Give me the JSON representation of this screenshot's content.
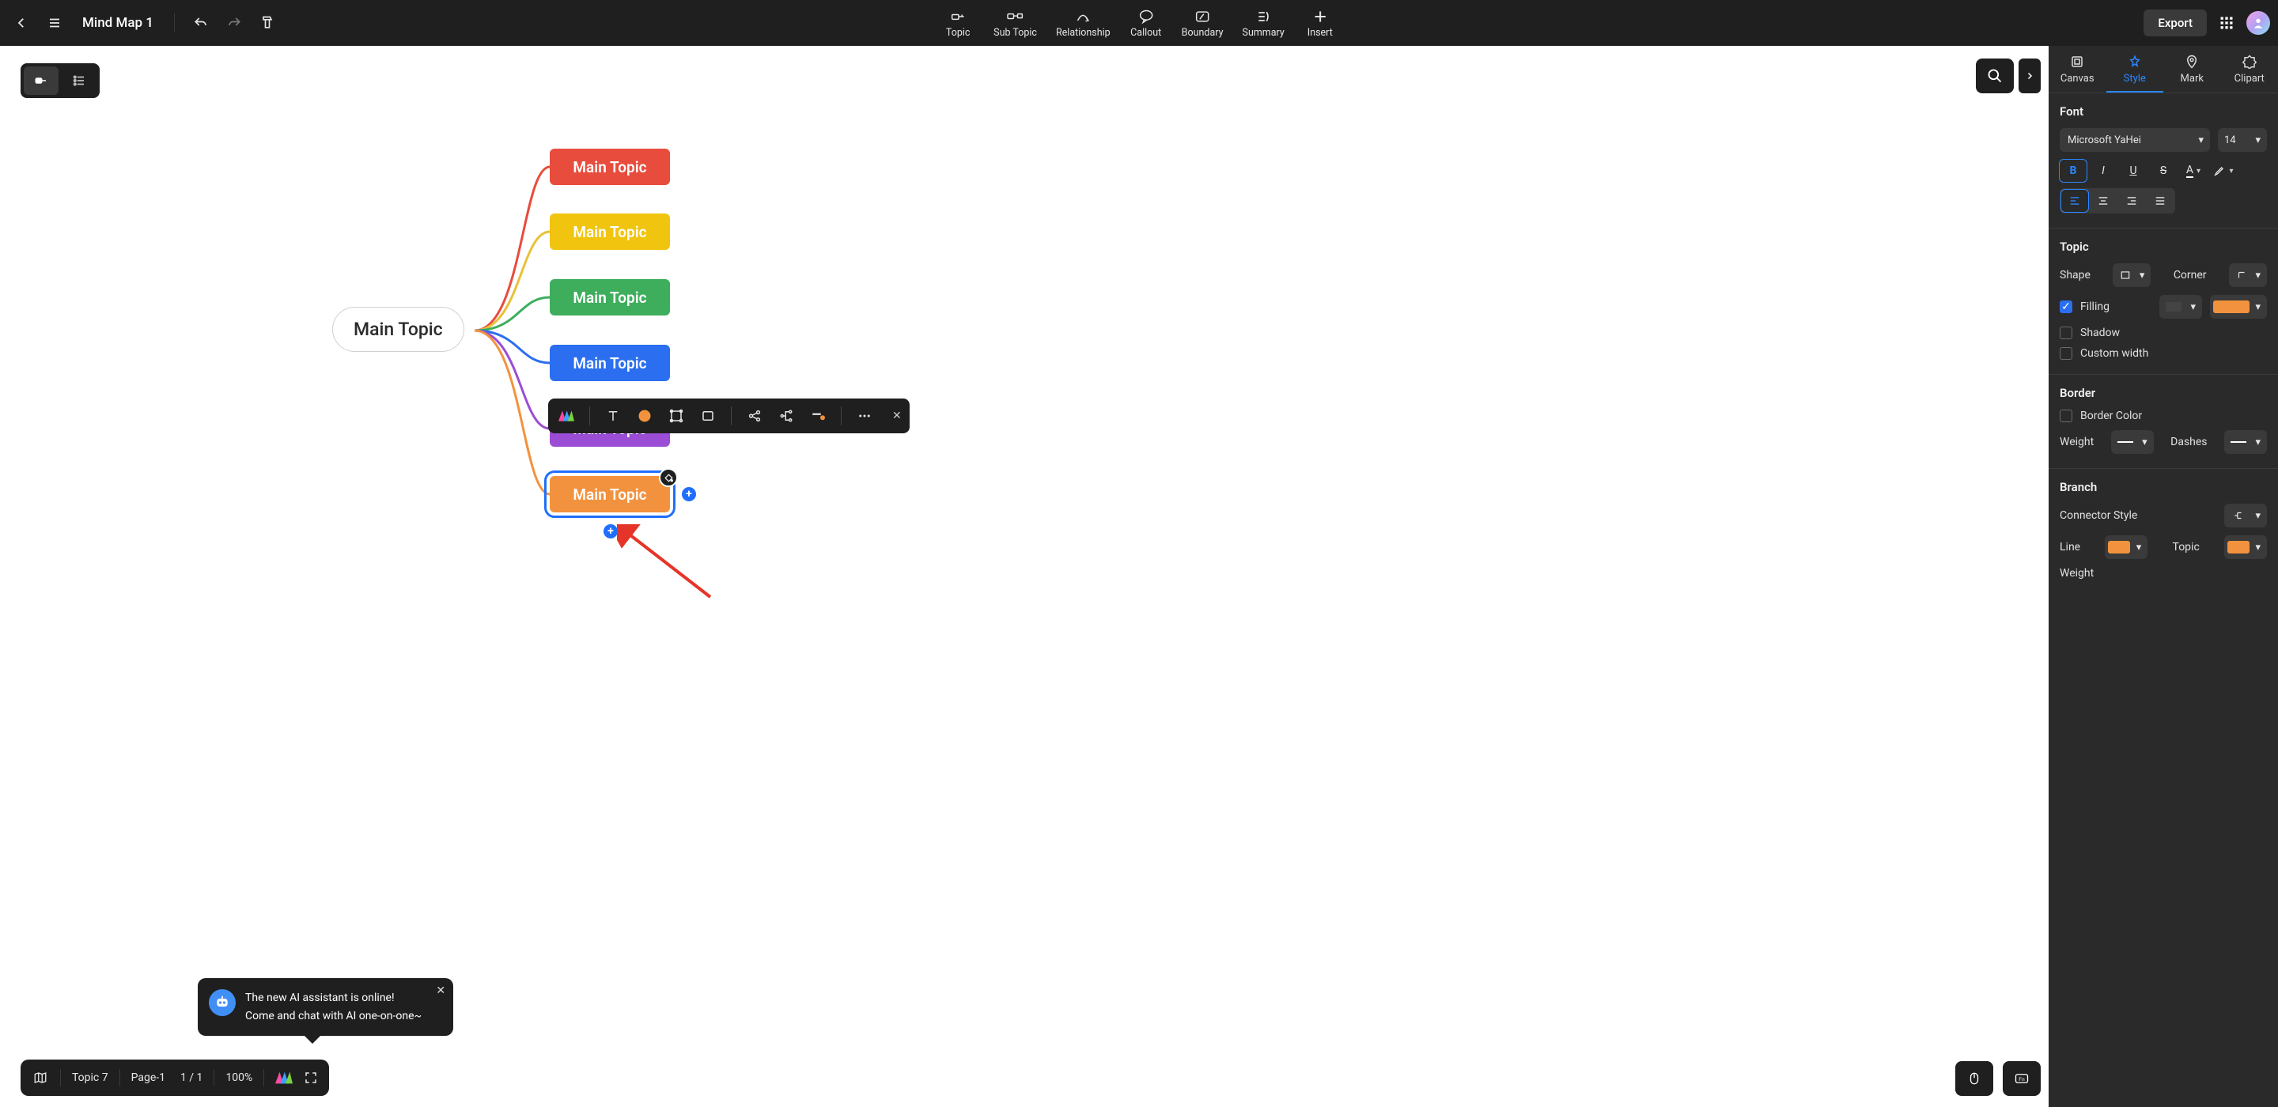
{
  "doc_title": "Mind Map 1",
  "toolbar": [
    {
      "id": "topic",
      "label": "Topic"
    },
    {
      "id": "subtopic",
      "label": "Sub Topic"
    },
    {
      "id": "relationship",
      "label": "Relationship"
    },
    {
      "id": "callout",
      "label": "Callout"
    },
    {
      "id": "boundary",
      "label": "Boundary"
    },
    {
      "id": "summary",
      "label": "Summary"
    },
    {
      "id": "insert",
      "label": "Insert"
    }
  ],
  "export_label": "Export",
  "mindmap": {
    "center_label": "Main Topic",
    "children": [
      {
        "label": "Main Topic",
        "color": "#e84c3d",
        "line": "#e84c3d"
      },
      {
        "label": "Main Topic",
        "color": "#f1c40f",
        "line": "#e8c13a"
      },
      {
        "label": "Main Topic",
        "color": "#3eae5d",
        "line": "#3eae5d"
      },
      {
        "label": "Main Topic",
        "color": "#2b6ff0",
        "line": "#2b6ff0"
      },
      {
        "label": "Main Topic",
        "color": "#9b4dd6",
        "line": "#9b4dd6"
      },
      {
        "label": "Main Topic",
        "color": "#f3923e",
        "line": "#f3923e",
        "selected": true
      }
    ]
  },
  "ai_popup": {
    "line1": "The new AI assistant is online!",
    "line2": "Come and chat with AI one-on-one~"
  },
  "status": {
    "topic": "Topic 7",
    "page_label": "Page-1",
    "page_count": "1 / 1",
    "zoom": "100%"
  },
  "panel": {
    "tabs": [
      "Canvas",
      "Style",
      "Mark",
      "Clipart"
    ],
    "active_tab": 1,
    "font": {
      "title": "Font",
      "family": "Microsoft YaHei",
      "size": "14"
    },
    "topic": {
      "title": "Topic",
      "shape_label": "Shape",
      "corner_label": "Corner",
      "filling_label": "Filling",
      "fill_color": "#f3923e",
      "shadow_label": "Shadow",
      "custom_width_label": "Custom width"
    },
    "border": {
      "title": "Border",
      "border_color_label": "Border Color",
      "weight_label": "Weight",
      "dashes_label": "Dashes"
    },
    "branch": {
      "title": "Branch",
      "connector_label": "Connector Style",
      "line_label": "Line",
      "line_color": "#f3923e",
      "topic_label": "Topic",
      "topic_color": "#f3923e",
      "weight_label": "Weight"
    }
  }
}
